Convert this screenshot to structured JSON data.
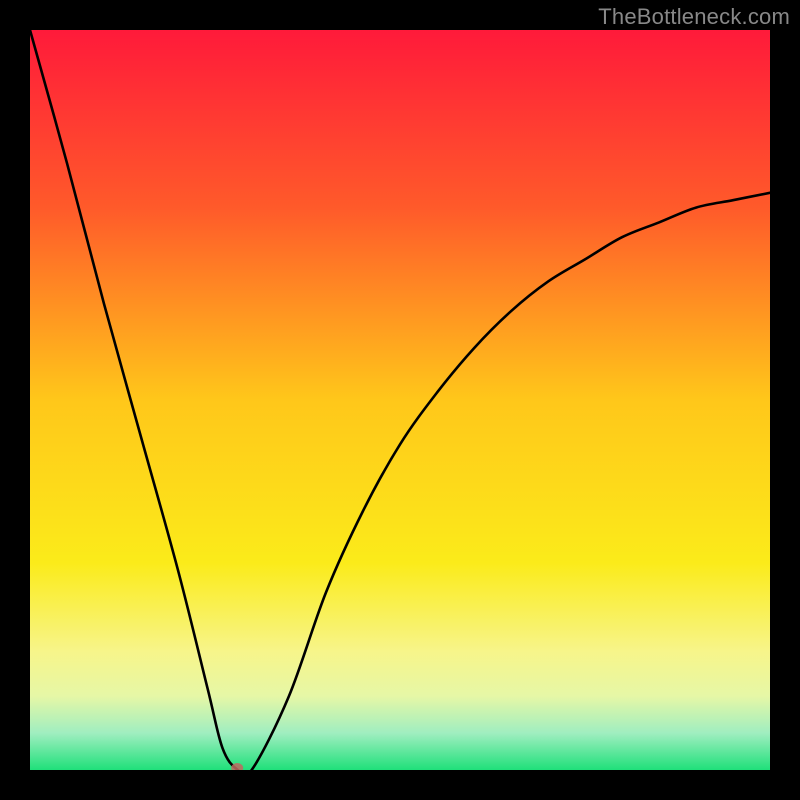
{
  "attribution": "TheBottleneck.com",
  "chart_data": {
    "type": "line",
    "title": "",
    "xlabel": "",
    "ylabel": "",
    "xlim": [
      0,
      100
    ],
    "ylim": [
      0,
      100
    ],
    "x": [
      0,
      5,
      10,
      15,
      20,
      24,
      26,
      28,
      30,
      35,
      40,
      45,
      50,
      55,
      60,
      65,
      70,
      75,
      80,
      85,
      90,
      95,
      100
    ],
    "values": [
      100,
      82,
      63,
      45,
      27,
      11,
      3,
      0,
      0,
      10,
      24,
      35,
      44,
      51,
      57,
      62,
      66,
      69,
      72,
      74,
      76,
      77,
      78
    ],
    "minimum_point": {
      "x": 28,
      "y": 0
    }
  },
  "gradient_stops": [
    {
      "offset": 0.0,
      "color": "#ff1a3a"
    },
    {
      "offset": 0.24,
      "color": "#ff5a2a"
    },
    {
      "offset": 0.5,
      "color": "#ffc71a"
    },
    {
      "offset": 0.72,
      "color": "#fbeb1a"
    },
    {
      "offset": 0.84,
      "color": "#f7f58a"
    },
    {
      "offset": 0.9,
      "color": "#e6f7a6"
    },
    {
      "offset": 0.95,
      "color": "#a0eec0"
    },
    {
      "offset": 1.0,
      "color": "#1fe07a"
    }
  ],
  "curve_style": {
    "stroke": "#000000",
    "width": 2.6
  },
  "marker": {
    "rx": 6,
    "ry": 5,
    "fill": "#c06860",
    "opacity": 0.85
  }
}
